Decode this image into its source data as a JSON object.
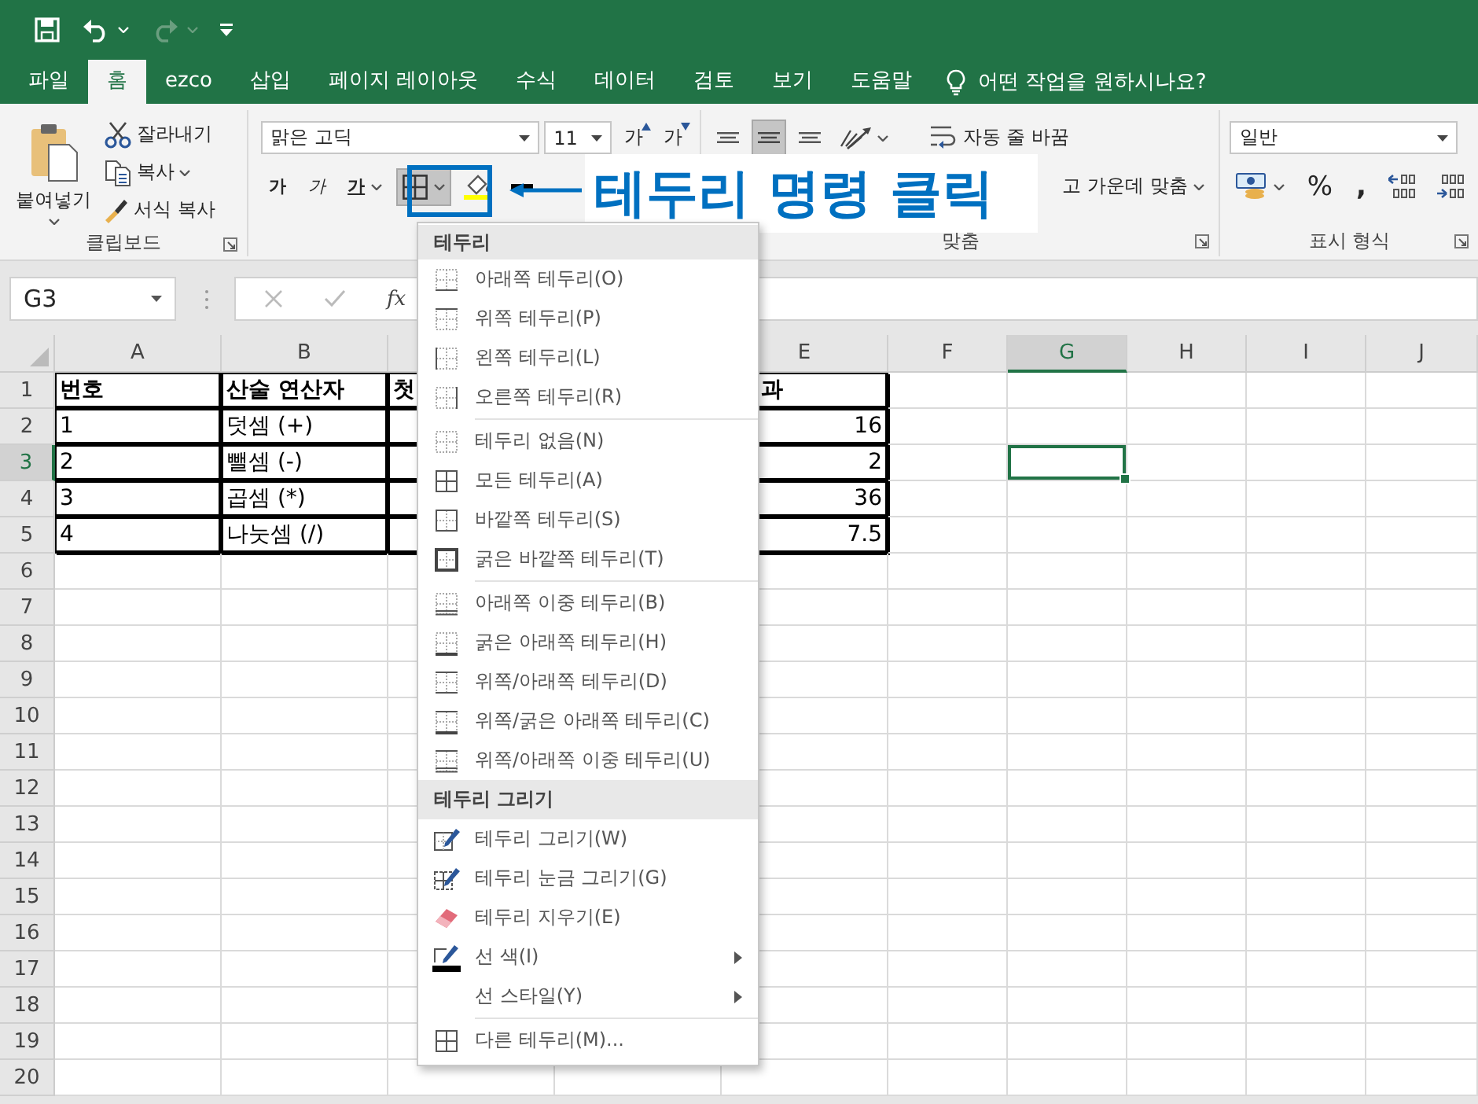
{
  "quick_access": {
    "redo_disabled": true
  },
  "tabs": [
    {
      "label": "파일",
      "selected": false
    },
    {
      "label": "홈",
      "selected": true
    },
    {
      "label": "ezco",
      "selected": false
    },
    {
      "label": "삽입",
      "selected": false
    },
    {
      "label": "페이지 레이아웃",
      "selected": false
    },
    {
      "label": "수식",
      "selected": false
    },
    {
      "label": "데이터",
      "selected": false
    },
    {
      "label": "검토",
      "selected": false
    },
    {
      "label": "보기",
      "selected": false
    },
    {
      "label": "도움말",
      "selected": false
    }
  ],
  "tell_me": {
    "placeholder": "어떤 작업을 원하시나요?"
  },
  "ribbon": {
    "clipboard": {
      "label": "클립보드",
      "paste": "붙여넣기",
      "cut": "잘라내기",
      "copy": "복사",
      "format_painter": "서식 복사"
    },
    "font": {
      "font_name": "맑은 고딕",
      "font_size": "11",
      "grow": "가",
      "shrink": "가",
      "bold": "가",
      "italic": "가",
      "underline": "가",
      "borders_pressed": true
    },
    "alignment": {
      "label": "맞춤",
      "middle_pressed": true,
      "wrap_text": "자동 줄 바꿈",
      "merge": "고 가운데 맞춤"
    },
    "number": {
      "label": "표시 형식",
      "format": "일반",
      "percent": "%",
      "comma": ","
    }
  },
  "annotation": {
    "text": "테두리 명령 클릭"
  },
  "border_menu": {
    "sections": [
      {
        "title": "테두리",
        "items": [
          {
            "kind": "bottom",
            "label": "아래쪽 테두리(O)"
          },
          {
            "kind": "top",
            "label": "위쪽 테두리(P)"
          },
          {
            "kind": "left",
            "label": "왼쪽 테두리(L)"
          },
          {
            "kind": "right",
            "label": "오른쪽 테두리(R)"
          },
          {
            "kind": "separator"
          },
          {
            "kind": "none",
            "label": "테두리 없음(N)"
          },
          {
            "kind": "all",
            "label": "모든 테두리(A)"
          },
          {
            "kind": "outside",
            "label": "바깥쪽 테두리(S)"
          },
          {
            "kind": "thick_outside",
            "label": "굵은 바깥쪽 테두리(T)"
          },
          {
            "kind": "separator"
          },
          {
            "kind": "double_bottom",
            "label": "아래쪽 이중 테두리(B)"
          },
          {
            "kind": "thick_bottom",
            "label": "굵은 아래쪽 테두리(H)"
          },
          {
            "kind": "top_bottom",
            "label": "위쪽/아래쪽 테두리(D)"
          },
          {
            "kind": "top_thick_bottom",
            "label": "위쪽/굵은 아래쪽 테두리(C)"
          },
          {
            "kind": "top_double_bottom",
            "label": "위쪽/아래쪽 이중 테두리(U)"
          }
        ]
      },
      {
        "title": "테두리 그리기",
        "items": [
          {
            "kind": "draw",
            "label": "테두리 그리기(W)"
          },
          {
            "kind": "draw_grid",
            "label": "테두리 눈금 그리기(G)"
          },
          {
            "kind": "erase",
            "label": "테두리 지우기(E)"
          },
          {
            "kind": "line_color",
            "label": "선 색(I)",
            "submenu": true
          },
          {
            "kind": "plain",
            "label": "선 스타일(Y)",
            "submenu": true
          },
          {
            "kind": "separator"
          },
          {
            "kind": "all",
            "label": "다른 테두리(M)..."
          }
        ]
      }
    ]
  },
  "formula_bar": {
    "name_box": "G3",
    "fx": "fx"
  },
  "columns": [
    {
      "label": "A",
      "selected": false
    },
    {
      "label": "B",
      "selected": false
    },
    {
      "selected": false
    },
    {},
    {
      "label": "E",
      "selected": false
    },
    {
      "label": "F",
      "selected": false
    },
    {
      "label": "G",
      "selected": true
    },
    {
      "label": "H",
      "selected": false
    },
    {
      "label": "I",
      "selected": false
    },
    {
      "label": "J",
      "selected": false
    }
  ],
  "rows": [
    {
      "label": "1",
      "selected": false,
      "cells": [
        {
          "text": "번호",
          "kind": "header",
          "bordered": true,
          "selected": false
        },
        {
          "text": "산술 연산자",
          "kind": "header",
          "bordered": true,
          "selected": false
        },
        {
          "text": "첫",
          "kind": "header",
          "bordered": true,
          "selected": false
        },
        {},
        {
          "text": "과",
          "kind": "overflow",
          "bordered": true,
          "selected": false
        },
        {
          "selected": false
        },
        {
          "selected": false
        },
        {
          "selected": false
        },
        {
          "selected": false
        },
        {
          "selected": false
        }
      ]
    },
    {
      "label": "2",
      "selected": false,
      "cells": [
        {
          "text": "1",
          "kind": "text",
          "bordered": true,
          "selected": false
        },
        {
          "text": "덧셈 (+)",
          "kind": "text",
          "bordered": true,
          "selected": false
        },
        {
          "bordered": true,
          "selected": false
        },
        {},
        {
          "text": "16",
          "kind": "number",
          "bordered": true,
          "selected": false
        },
        {
          "selected": false
        },
        {
          "selected": false
        },
        {
          "selected": false
        },
        {
          "selected": false
        },
        {
          "selected": false
        }
      ]
    },
    {
      "label": "3",
      "selected": true,
      "cells": [
        {
          "text": "2",
          "kind": "text",
          "bordered": true,
          "selected": false
        },
        {
          "text": "뺄셈 (-)",
          "kind": "text",
          "bordered": true,
          "selected": false
        },
        {
          "bordered": true,
          "selected": false
        },
        {},
        {
          "text": "2",
          "kind": "number",
          "bordered": true,
          "selected": false
        },
        {
          "selected": false
        },
        {
          "selected": true
        },
        {
          "selected": false
        },
        {
          "selected": false
        },
        {
          "selected": false
        }
      ]
    },
    {
      "label": "4",
      "selected": false,
      "cells": [
        {
          "text": "3",
          "kind": "text",
          "bordered": true,
          "selected": false
        },
        {
          "text": "곱셈 (*)",
          "kind": "text",
          "bordered": true,
          "selected": false
        },
        {
          "bordered": true,
          "selected": false
        },
        {},
        {
          "text": "36",
          "kind": "number",
          "bordered": true,
          "selected": false
        },
        {
          "selected": false
        },
        {
          "selected": false
        },
        {
          "selected": false
        },
        {
          "selected": false
        },
        {
          "selected": false
        }
      ]
    },
    {
      "label": "5",
      "selected": false,
      "cells": [
        {
          "text": "4",
          "kind": "text",
          "bordered": true,
          "selected": false
        },
        {
          "text": "나눗셈 (/)",
          "kind": "text",
          "bordered": true,
          "selected": false
        },
        {
          "bordered": true,
          "selected": false
        },
        {},
        {
          "text": "7.5",
          "kind": "number",
          "bordered": true,
          "selected": false
        },
        {
          "selected": false
        },
        {
          "selected": false
        },
        {
          "selected": false
        },
        {
          "selected": false
        },
        {
          "selected": false
        }
      ]
    },
    {
      "label": "6",
      "selected": false
    },
    {
      "label": "7",
      "selected": false
    },
    {
      "label": "8",
      "selected": false
    },
    {
      "label": "9",
      "selected": false
    },
    {
      "label": "10",
      "selected": false
    },
    {
      "label": "11",
      "selected": false
    },
    {
      "label": "12",
      "selected": false
    },
    {
      "label": "13",
      "selected": false
    },
    {
      "label": "14",
      "selected": false
    },
    {
      "label": "15",
      "selected": false
    },
    {
      "label": "16",
      "selected": false
    },
    {
      "label": "17",
      "selected": false
    },
    {
      "label": "18",
      "selected": false
    },
    {
      "label": "19",
      "selected": false
    },
    {
      "label": "20",
      "selected": false
    }
  ]
}
